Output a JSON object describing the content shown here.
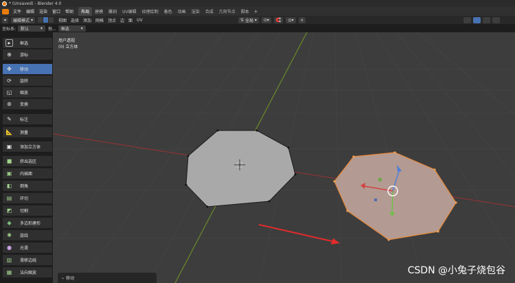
{
  "window": {
    "title": "* (Unsaved) - Blender 4.0"
  },
  "menu": [
    "文件",
    "编辑",
    "渲染",
    "窗口",
    "帮助"
  ],
  "workspaces": [
    "布局",
    "建模",
    "雕刻",
    "UV编辑",
    "纹理绘制",
    "着色",
    "动画",
    "渲染",
    "合成",
    "几何节点",
    "脚本"
  ],
  "active_workspace": "布局",
  "header": {
    "mode": "编辑模式",
    "menus": [
      "视图",
      "选择",
      "添加",
      "网格",
      "顶点",
      "边",
      "面",
      "UV"
    ],
    "orientation": "全局"
  },
  "header2": {
    "coord_label": "坐标系:",
    "coord_value": "默认",
    "drag_label": "拖...",
    "drag_value": "框选"
  },
  "tools": [
    {
      "label": "框选",
      "icon": "select-box-icon",
      "active": false
    },
    {
      "label": "游标",
      "icon": "cursor-icon",
      "active": false
    },
    {
      "label": "移动",
      "icon": "move-icon",
      "active": true
    },
    {
      "label": "旋转",
      "icon": "rotate-icon",
      "active": false
    },
    {
      "label": "缩放",
      "icon": "scale-icon",
      "active": false
    },
    {
      "label": "变换",
      "icon": "transform-icon",
      "active": false
    },
    {
      "label": "标注",
      "icon": "annotate-icon",
      "active": false
    },
    {
      "label": "测量",
      "icon": "measure-icon",
      "active": false
    },
    {
      "label": "添加立方体",
      "icon": "add-cube-icon",
      "active": false
    },
    {
      "label": "挤出选区",
      "icon": "extrude-icon",
      "active": false
    },
    {
      "label": "内插面",
      "icon": "inset-icon",
      "active": false
    },
    {
      "label": "倒角",
      "icon": "bevel-icon",
      "active": false
    },
    {
      "label": "环切",
      "icon": "loop-cut-icon",
      "active": false
    },
    {
      "label": "切割",
      "icon": "knife-icon",
      "active": false
    },
    {
      "label": "多边形建形",
      "icon": "poly-build-icon",
      "active": false
    },
    {
      "label": "旋绕",
      "icon": "spin-icon",
      "active": false
    },
    {
      "label": "光滑",
      "icon": "smooth-icon",
      "active": false
    },
    {
      "label": "滑移边线",
      "icon": "edge-slide-icon",
      "active": false
    },
    {
      "label": "法向缩放",
      "icon": "shrink-fatten-icon",
      "active": false
    }
  ],
  "viewport": {
    "view_name": "用户透视",
    "object_name": "(0) 立方体"
  },
  "operator_panel": {
    "label": "移动"
  },
  "watermark": "CSDN @小兔子烧包谷",
  "colors": {
    "accent": "#4772b3",
    "selection": "#e8893a",
    "x_axis": "#9c3a3a",
    "y_axis": "#6a8a2a",
    "annotation_arrow": "#e52b2b"
  }
}
